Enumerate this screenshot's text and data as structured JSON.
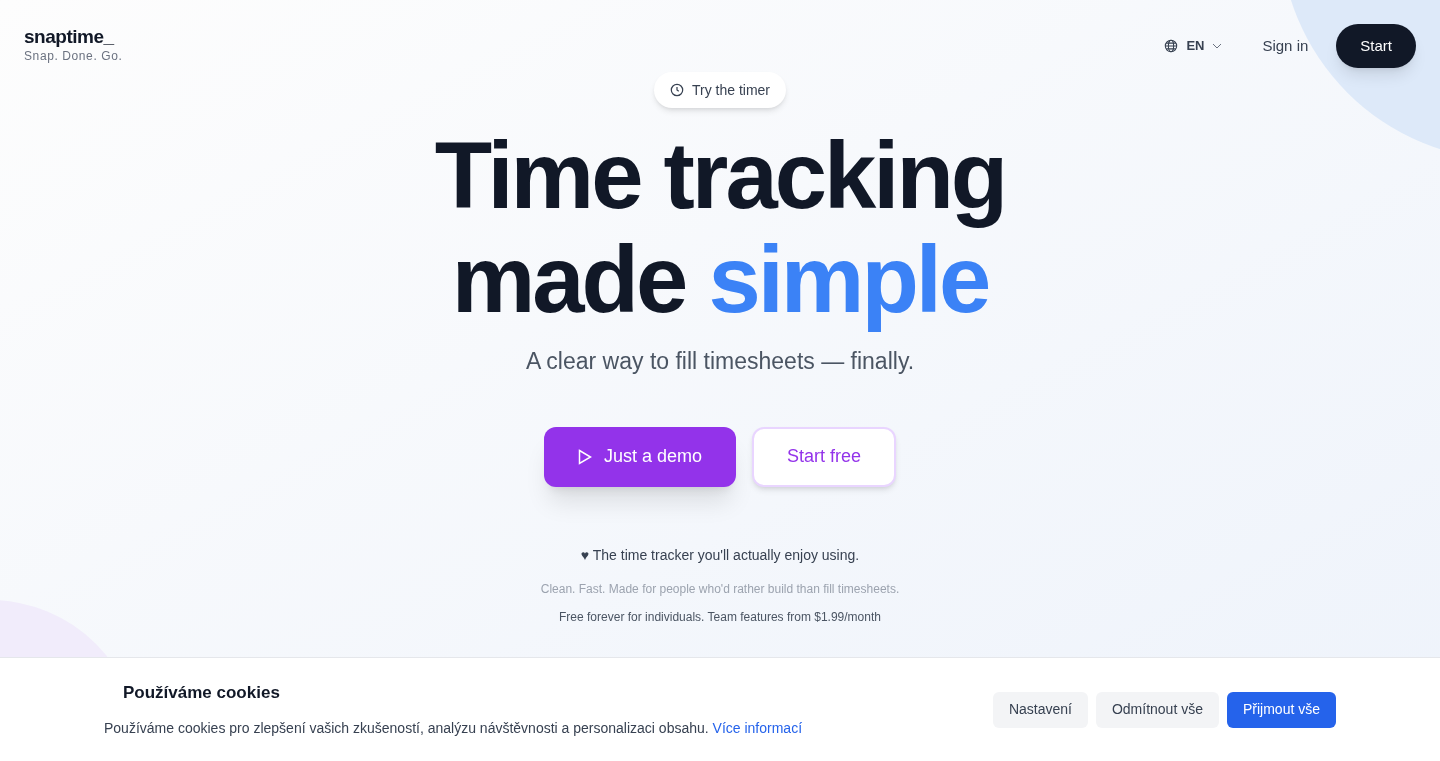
{
  "header": {
    "logo": "snaptime_",
    "tagline": "Snap. Done. Go.",
    "language": "EN",
    "sign_in": "Sign in",
    "start": "Start"
  },
  "hero": {
    "badge": "Try the timer",
    "headline": {
      "line_1": "Time tracking",
      "line_2": "made",
      "highlight": "simple"
    },
    "subtitle": "A clear way to fill timesheets — finally.",
    "buttons": [
      {
        "label": "Just a demo",
        "kind": "primary"
      },
      {
        "label": "Start free",
        "kind": "secondary"
      }
    ],
    "tagline": "♥ The time tracker you'll actually enjoy using.",
    "note": "Clean. Fast. Made for people who'd rather build than fill timesheets.",
    "pricing": "Free forever for individuals. Team features from $1.99/month"
  },
  "cookie_banner": {
    "title": "Používáme cookies",
    "text": "Používáme cookies pro zlepšení vašich zkušeností, analýzu návštěvnosti a personalizaci obsahu.",
    "link": "Více informací",
    "buttons": [
      {
        "label": "Nastavení",
        "kind": "secondary"
      },
      {
        "label": "Odmítnout vše",
        "kind": "secondary"
      },
      {
        "label": "Přijmout vše",
        "kind": "primary"
      }
    ]
  }
}
